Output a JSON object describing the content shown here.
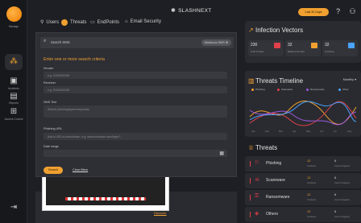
{
  "sidebar": {
    "logo_label": "Manage",
    "items": [
      {
        "icon": "grid-dots-icon",
        "label": ""
      },
      {
        "icon": "incidents-icon",
        "label": "Incidents"
      },
      {
        "icon": "reports-icon",
        "label": "Reports"
      },
      {
        "icon": "access-control-icon",
        "label": "Access Control"
      },
      {
        "icon": "logout-icon",
        "label": ""
      }
    ]
  },
  "topbar": {
    "brand": "SLASHNEXT",
    "nav": [
      {
        "icon": "users-icon",
        "label": "Users"
      },
      {
        "icon": "threats-icon",
        "label": "Threats"
      },
      {
        "icon": "endpoints-icon",
        "label": "EndPoints"
      },
      {
        "icon": "email-security-icon",
        "label": "Email Security"
      }
    ],
    "pill": "Last 30 Days",
    "accent": "#f0a030"
  },
  "search": {
    "placeholder": "Search SMS",
    "malicious_badge": "Malicious SMS"
  },
  "criteria": {
    "title": "Enter one or more search criteria",
    "fields": [
      {
        "label": "Sender",
        "placeholder": "e.g. 9100234189"
      },
      {
        "label": "Receiver",
        "placeholder": "e.g. 9100234189"
      },
      {
        "label": "SMS Text",
        "placeholder": "Search phishing/spam keywords"
      },
      {
        "label": "Phishing URL",
        "placeholder": "Add a URL to check/scan, e.g. www.example.com/login?..."
      },
      {
        "label": "Date range",
        "placeholder": ""
      }
    ],
    "search_button": "Search",
    "clear_link": "Clear filters"
  },
  "preview": {
    "link": "Discover"
  },
  "infection_vectors": {
    "title": "Infection Vectors",
    "items": [
      {
        "value": "230",
        "label": "Total Threats",
        "tag_color": "#e0404a"
      },
      {
        "value": "32",
        "label": "Malicious Emails",
        "tag_color": "#f0a030"
      },
      {
        "value": "32",
        "label": "Smishing",
        "tag_color": "#4aa3ff"
      }
    ]
  },
  "timeline": {
    "title": "Threats Timeline",
    "dropdown": "Monthly",
    "legend": [
      {
        "name": "Phishing",
        "color": "#f0a030"
      },
      {
        "name": "Scareware",
        "color": "#e0404a"
      },
      {
        "name": "Ransomware",
        "color": "#9b59e0"
      },
      {
        "name": "Other",
        "color": "#4aa3ff"
      }
    ],
    "x_ticks": [
      "Jan",
      "Feb",
      "Mar",
      "Apr",
      "May",
      "Jun",
      "Jul",
      "Aug"
    ]
  },
  "threats": {
    "title": "Threats",
    "rows": [
      {
        "name": "Phishing",
        "v1": "12",
        "l1": "Incidents",
        "v2": "6",
        "l2": "Users Targeted"
      },
      {
        "name": "Scareware",
        "v1": "12",
        "l1": "Incidents",
        "v2": "6",
        "l2": "Users Targeted"
      },
      {
        "name": "Ransomware",
        "v1": "12",
        "l1": "Incidents",
        "v2": "6",
        "l2": "Users Targeted"
      },
      {
        "name": "Others",
        "v1": "12",
        "l1": "Incidents",
        "v2": "6",
        "l2": "Users Targeted"
      }
    ]
  }
}
